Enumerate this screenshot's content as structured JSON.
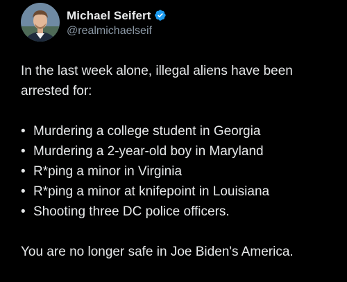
{
  "author": {
    "display_name": "Michael Seifert",
    "handle": "@realmichaelseif",
    "verified": true,
    "verified_badge_color": "#1d9bf0"
  },
  "tweet": {
    "intro": "In the last week alone, illegal aliens have been arrested for:",
    "bullet_symbol": "•",
    "items": [
      "Murdering a college student in Georgia",
      "Murdering a 2-year-old boy in Maryland",
      "R*ping a minor in Virginia",
      "R*ping a minor at knifepoint in Louisiana",
      "Shooting three DC police officers."
    ],
    "closing": "You are no longer safe in Joe Biden's America."
  },
  "colors": {
    "background": "#000000",
    "text": "#e7e9ea",
    "muted": "#8b98a5"
  }
}
